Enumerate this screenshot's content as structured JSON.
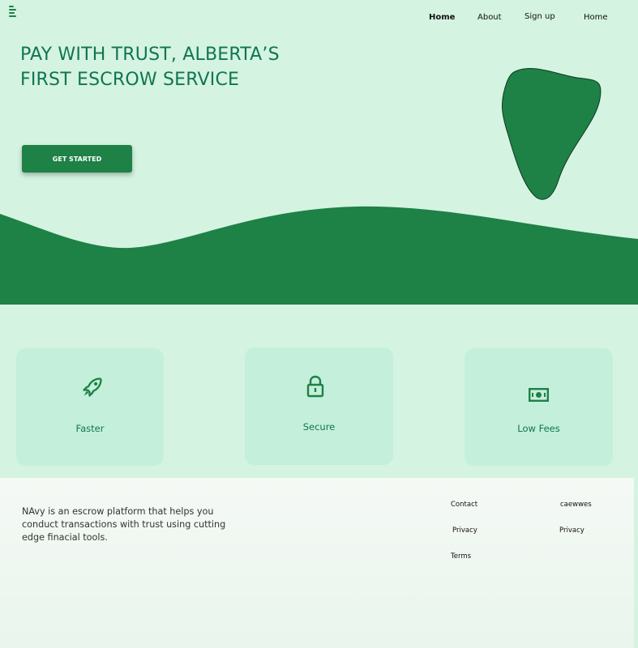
{
  "header": {
    "menu_icon": "hamburger-menu-icon",
    "nav": {
      "home_1": "Home",
      "about": "About",
      "sign_up": "Sign up",
      "home_2": "Home"
    }
  },
  "hero": {
    "headline_line1": "PAY WITH TRUST, ALBERTA’S",
    "headline_line2": "FIRST ESCROW SERVICE",
    "cta_label": "GET STARTED"
  },
  "features": [
    {
      "label": "Faster",
      "icon": "rocket-icon"
    },
    {
      "label": "Secure",
      "icon": "lock-icon"
    },
    {
      "label": "Low Fees",
      "icon": "money-icon"
    }
  ],
  "footer": {
    "description": "NAvy is an escrow platform that helps you conduct transactions with trust using cutting edge finacial tools.",
    "links_col1": [
      "Contact",
      "Privacy",
      "Terms"
    ],
    "links_col2": [
      "caewwes",
      "Privacy"
    ]
  },
  "colors": {
    "background": "#d4f3e1",
    "brand_green": "#1e8145",
    "headline_teal": "#107551",
    "card_bg": "#c4efdb"
  }
}
